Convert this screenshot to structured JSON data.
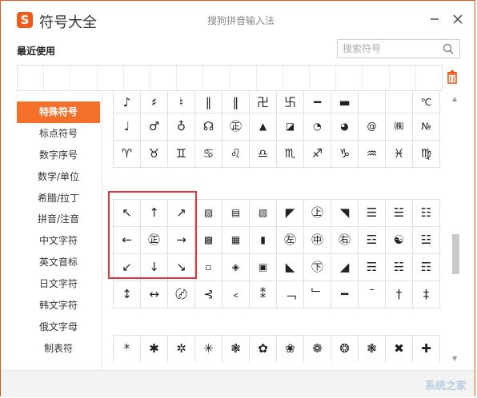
{
  "window": {
    "app_title": "符号大全",
    "ime_title": "搜狗拼音输入法",
    "logo_letter": "S",
    "brand_color": "#f05a1a"
  },
  "recent": {
    "label": "最近使用"
  },
  "search": {
    "placeholder": "搜索符号"
  },
  "sidebar": {
    "items": [
      {
        "label": "特殊符号",
        "active": true
      },
      {
        "label": "标点符号"
      },
      {
        "label": "数字序号"
      },
      {
        "label": "数学/单位"
      },
      {
        "label": "希腊/拉丁"
      },
      {
        "label": "拼音/注音"
      },
      {
        "label": "中文字符"
      },
      {
        "label": "英文音标"
      },
      {
        "label": "日文字符"
      },
      {
        "label": "韩文字符"
      },
      {
        "label": "俄文字母"
      },
      {
        "label": "制表符"
      }
    ]
  },
  "symbols": {
    "partial_row": [
      "♪",
      "♯",
      "♮",
      "‖",
      "‖",
      "卍",
      "卐",
      "━",
      "▬",
      "",
      "",
      "℃"
    ],
    "row1": [
      "♩",
      "♂",
      "♁",
      "☊",
      "㊣",
      "▲",
      "◪",
      "◔",
      "◕",
      "@",
      "㈱",
      "№"
    ],
    "row2": [
      "♈",
      "♉",
      "♊",
      "♋",
      "♌",
      "♎",
      "♏",
      "♐",
      "♑",
      "♒",
      "♓",
      "♍"
    ],
    "row3": [
      "↖",
      "↑",
      "↗",
      "▨",
      "▤",
      "▧",
      "◤",
      "㊤",
      "◥",
      "☰",
      "☱",
      "☷"
    ],
    "row4": [
      "←",
      "㊣",
      "→",
      "▩",
      "▦",
      "▮",
      "㊧",
      "㊥",
      "㊨",
      "☲",
      "☯",
      "☳"
    ],
    "row5": [
      "↙",
      "↓",
      "↘",
      "▫",
      "◈",
      "▣",
      "◣",
      "㊦",
      "◢",
      "☴",
      "☵",
      "☶"
    ],
    "row6": [
      "↕",
      "↔",
      "〄",
      "⊰",
      "﹤",
      "⁑",
      "﹁",
      "﹂",
      "━",
      "ˉ",
      "†",
      "‡"
    ],
    "row7": [
      "*",
      "✱",
      "✲",
      "✳",
      "❃",
      "✿",
      "❀",
      "❁",
      "❂",
      "❃",
      "✖",
      "✚"
    ]
  },
  "watermark": "系统之家"
}
